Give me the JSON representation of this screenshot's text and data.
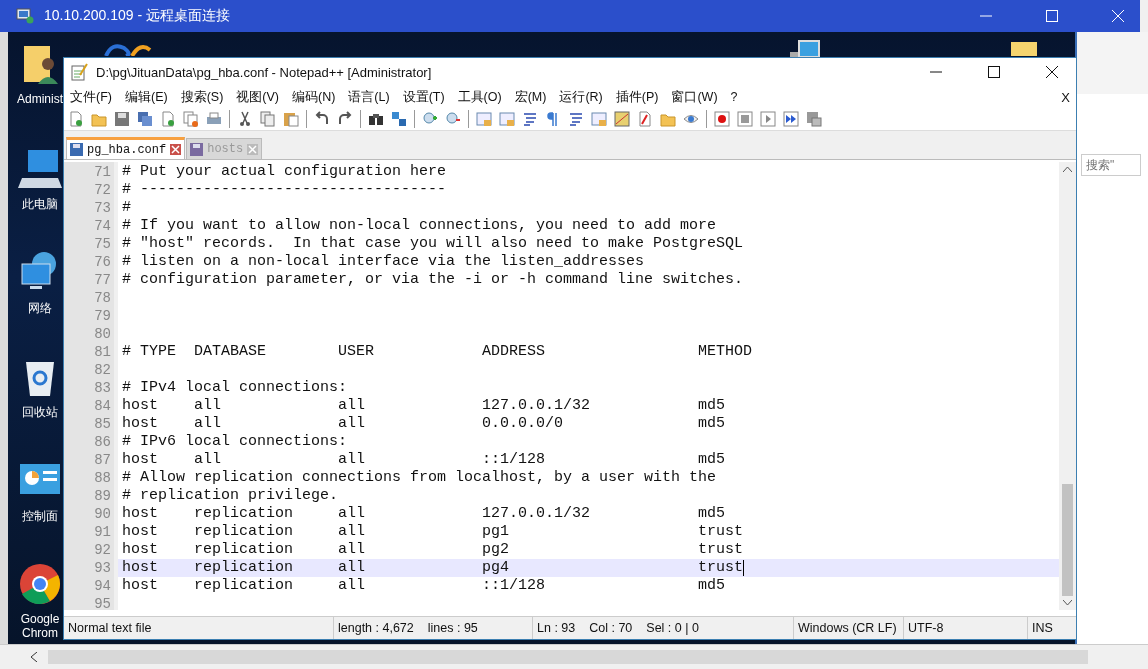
{
  "rdp_window": {
    "title": "10.10.200.109 - 远程桌面连接"
  },
  "desktop_icons": [
    {
      "label": "Administ",
      "kind": "user-folder"
    },
    {
      "label": "此电脑",
      "kind": "computer"
    },
    {
      "label": "网络",
      "kind": "network"
    },
    {
      "label": "回收站",
      "kind": "recycle-bin"
    },
    {
      "label": "控制面",
      "kind": "control-panel"
    },
    {
      "label": "Google Chrom",
      "kind": "chrome"
    }
  ],
  "side_panel": {
    "search": {
      "placeholder": "搜索\""
    }
  },
  "editor_window": {
    "title": "D:\\pg\\JituanData\\pg_hba.conf - Notepad++ [Administrator]",
    "menu": [
      "文件(F)",
      "编辑(E)",
      "搜索(S)",
      "视图(V)",
      "编码(N)",
      "语言(L)",
      "设置(T)",
      "工具(O)",
      "宏(M)",
      "运行(R)",
      "插件(P)",
      "窗口(W)",
      "?"
    ],
    "menu_close": "X",
    "tabs": [
      {
        "label": "pg_hba.conf",
        "selected": true
      },
      {
        "label": "hosts",
        "selected": false
      }
    ],
    "lines": [
      {
        "number": "71",
        "text": "# Put your actual configuration here",
        "selected": false
      },
      {
        "number": "72",
        "text": "# ----------------------------------",
        "selected": false
      },
      {
        "number": "73",
        "text": "#",
        "selected": false
      },
      {
        "number": "74",
        "text": "# If you want to allow non-local connections, you need to add more",
        "selected": false
      },
      {
        "number": "75",
        "text": "# \"host\" records.  In that case you will also need to make PostgreSQL",
        "selected": false
      },
      {
        "number": "76",
        "text": "# listen on a non-local interface via the listen_addresses",
        "selected": false
      },
      {
        "number": "77",
        "text": "# configuration parameter, or via the -i or -h command line switches.",
        "selected": false
      },
      {
        "number": "78",
        "selected": false
      },
      {
        "number": "79",
        "selected": false
      },
      {
        "number": "80",
        "selected": false
      },
      {
        "number": "81",
        "text": "# TYPE  DATABASE        USER            ADDRESS                 METHOD",
        "selected": false
      },
      {
        "number": "82",
        "selected": false
      },
      {
        "number": "83",
        "text": "# IPv4 local connections:",
        "selected": false
      },
      {
        "number": "84",
        "text": "host    all             all             127.0.0.1/32            md5",
        "selected": false
      },
      {
        "number": "85",
        "text": "host    all             all             0.0.0.0/0               md5",
        "selected": false
      },
      {
        "number": "86",
        "text": "# IPv6 local connections:",
        "selected": false
      },
      {
        "number": "87",
        "text": "host    all             all             ::1/128                 md5",
        "selected": false
      },
      {
        "number": "88",
        "text": "# Allow replication connections from localhost, by a user with the",
        "selected": false
      },
      {
        "number": "89",
        "text": "# replication privilege.",
        "selected": false
      },
      {
        "number": "90",
        "text": "host    replication     all             127.0.0.1/32            md5",
        "selected": false
      },
      {
        "number": "91",
        "text": "host    replication     all             pg1                     trust",
        "selected": false
      },
      {
        "number": "92",
        "text": "host    replication     all             pg2                     trust",
        "selected": false
      },
      {
        "number": "93",
        "text": "host    replication     all             pg4                     trust",
        "selected": true
      },
      {
        "number": "94",
        "text": "host    replication     all             ::1/128                 md5",
        "selected": false
      },
      {
        "number": "95",
        "selected": false
      }
    ],
    "status_bar": {
      "file_type": "Normal text file",
      "length": "length : 4,672",
      "lines": "lines : 95",
      "line": "Ln : 93",
      "column": "Col : 70",
      "selection": "Sel : 0 | 0",
      "eol": "Windows (CR LF)",
      "encoding": "UTF-8",
      "mode": "INS"
    }
  }
}
